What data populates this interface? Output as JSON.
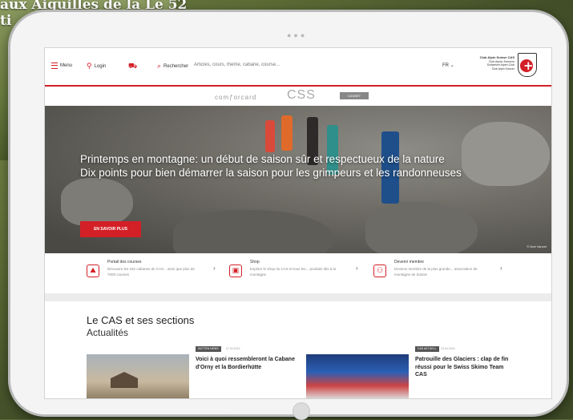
{
  "background": {
    "caption_line1": "aux Aiguilles de la Le 52",
    "caption_line2": "ti"
  },
  "header": {
    "menu_label": "Menu",
    "login_label": "Login",
    "search_label": "Rechercher",
    "search_placeholder": "Articles, cours, thème, cabane, course...",
    "language": "FR ⌄",
    "club_name": "Club Alpin Suisse CAS",
    "club_line2": "Club Alpino Svizzero",
    "club_line3": "Schweizer Alpen-Club",
    "club_line4": "Club Alpin Svizzer"
  },
  "sponsors": {
    "sponsor1": "comƒorcard",
    "sponsor2": "CSS",
    "sponsor3": "CASNET"
  },
  "hero": {
    "title": "Printemps en montagne: un début de saison sûr et respectueux de la nature",
    "subtitle": "Dix points pour bien démarrer la saison pour les grimpeurs et les randonneuses",
    "button_label": "EN SAVOIR PLUS",
    "photo_credit": "© Noé Vanoni"
  },
  "services": [
    {
      "title": "Portail des courses",
      "desc": "Découvre les 152 cabanes du CAS... ainsi que plus de 7000 courses",
      "icon": "mountain-icon"
    },
    {
      "title": "Shop",
      "desc": "Explore le shop du CAS et tous les... produits liés à la montagne",
      "icon": "shop-bag-icon"
    },
    {
      "title": "Devenir membre",
      "desc": "Deviens membre de la plus grande... association de montagne de Suisse",
      "icon": "member-add-icon"
    }
  ],
  "news": {
    "heading": "Le CAS et ses sections",
    "subheading": "Actualités",
    "cards": [
      {
        "tag": "HUTTEN NEWS",
        "date": "07.03.2024",
        "title": "Voici à quoi ressembleront la Cabane d'Orny et la Bordierhütte"
      },
      {
        "tag": "CAS AKTUELL",
        "date": "23.04.2024",
        "title": "Patrouille des Glaciers : clap de fin réussi pour le Swiss Skimo Team CAS"
      }
    ]
  },
  "colors": {
    "accent": "#d31f26"
  }
}
